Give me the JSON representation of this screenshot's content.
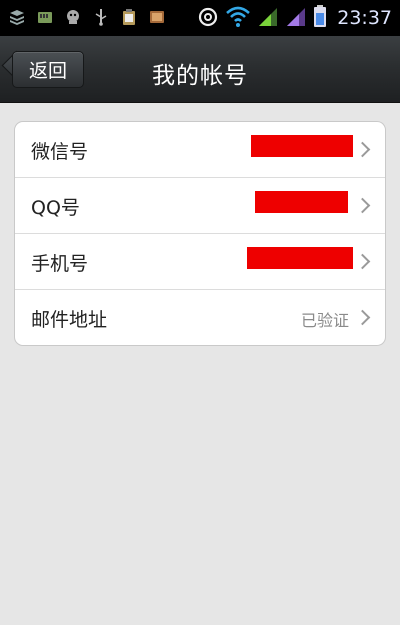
{
  "status_bar": {
    "time": "23:37",
    "icons_left": [
      "stack-icon",
      "sd-card-icon",
      "android-icon",
      "usb-icon",
      "clipboard-icon",
      "image-icon"
    ],
    "icons_right": [
      "at-sign-icon",
      "wifi-icon",
      "signal-icon",
      "signal-icon",
      "battery-icon"
    ]
  },
  "title_bar": {
    "back_label": "返回",
    "title": "我的帐号"
  },
  "account_list": {
    "items": [
      {
        "label": "微信号",
        "value": "",
        "redacted": true
      },
      {
        "label": "QQ号",
        "value": "",
        "redacted": true
      },
      {
        "label": "手机号",
        "value": "",
        "redacted": true
      },
      {
        "label": "邮件地址",
        "value": "已验证",
        "redacted": false
      }
    ]
  },
  "colors": {
    "redaction": "#ee0000",
    "title_bar": "#2b2e30",
    "background": "#e6e6e6"
  }
}
